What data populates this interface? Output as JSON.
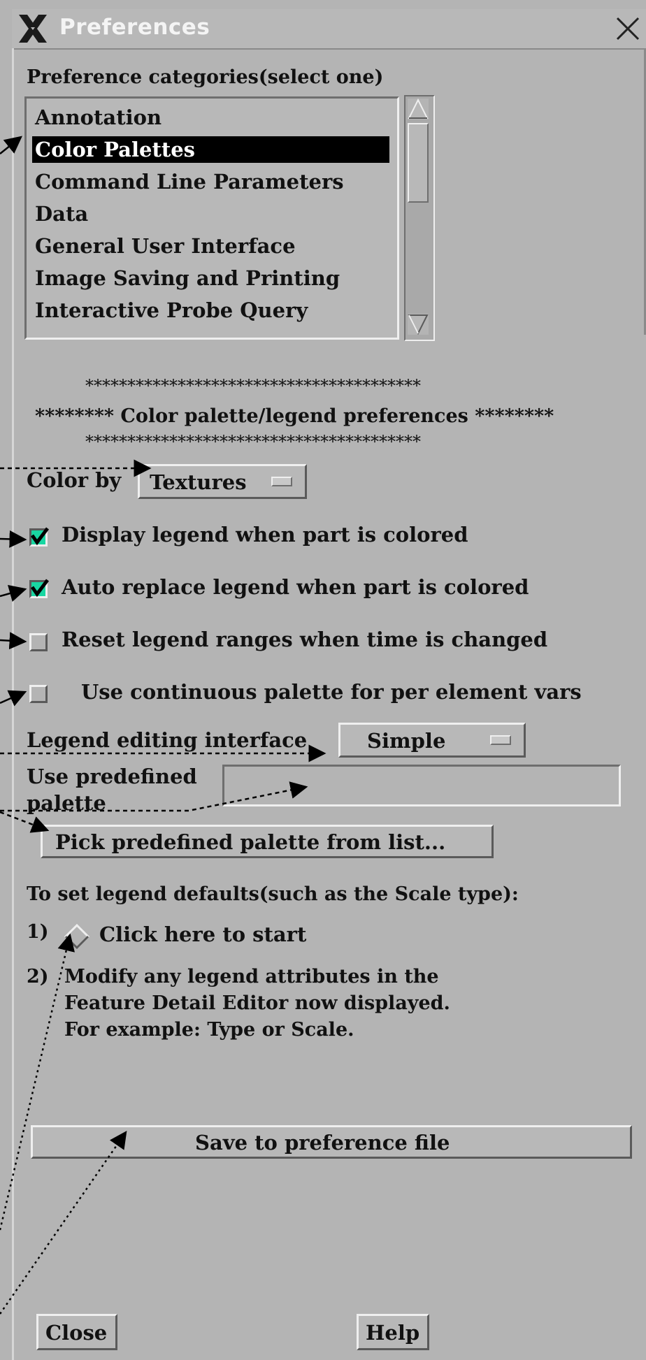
{
  "window": {
    "title": "Preferences"
  },
  "categories": {
    "label": "Preference categories(select one)",
    "items": [
      "Annotation",
      "Color Palettes",
      "Command Line Parameters",
      "Data",
      "General User Interface",
      "Image Saving and Printing",
      "Interactive Probe Query"
    ],
    "selected": "Color Palettes"
  },
  "section_header": {
    "line1": "****************************************",
    "line2": "******** Color palette/legend preferences ********",
    "line3": "****************************************"
  },
  "color_by": {
    "label": "Color by",
    "value": "Textures"
  },
  "options": {
    "display_legend": {
      "label": "Display legend when part is colored",
      "checked": true
    },
    "auto_replace": {
      "label": "Auto replace legend when part is colored",
      "checked": true
    },
    "reset_ranges": {
      "label": "Reset legend ranges when time is changed",
      "checked": false
    },
    "continuous_palette": {
      "label": "Use continuous palette for per element vars",
      "checked": false
    }
  },
  "legend_editing": {
    "label": "Legend editing interface",
    "value": "Simple"
  },
  "predefined": {
    "label_line1": "Use predefined",
    "label_line2": "palette",
    "value": "",
    "pick_button": "Pick predefined palette from list..."
  },
  "legend_defaults": {
    "heading": "To set legend defaults(such as the Scale type):",
    "step1_num": "1)",
    "step1_label": "Click here to start",
    "step2_num": "2)",
    "step2_line1": "Modify any legend attributes in the",
    "step2_line2": "Feature Detail Editor now displayed.",
    "step2_line3": "For example: Type or Scale."
  },
  "save_button": "Save to preference file",
  "footer": {
    "close": "Close",
    "help": "Help"
  },
  "colors": {
    "background": "#b4b4b4",
    "checked": "#19d6a2",
    "selection": "#000000"
  }
}
